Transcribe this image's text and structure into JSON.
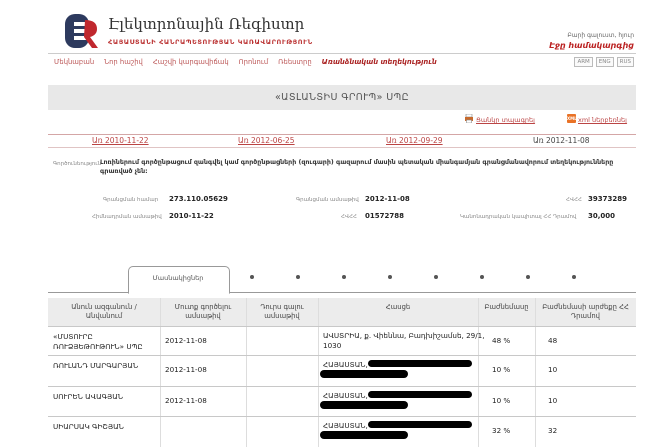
{
  "brand": {
    "title": "Էլեկտրոնային Ռեգիստր",
    "subtitle": "ՀԱՅԱՍՏԱՆԻ ՀԱՆՐԱՊԵՏՈՒԹՅԱՆ ԿԱՌԱՎԱՐՈՒԹՅՈՒՆ",
    "welcome": "Բարի գալուստ, հյուր",
    "login": "Էջը համակարգից",
    "accent_color": "#b22222"
  },
  "nav": [
    "Մեկնաբան",
    "Նոր հաշիվ",
    "Հաշվի կարգավիճակ",
    "Որոնում",
    "Ռեեստրը",
    "Առանձնական տեղեկություն"
  ],
  "nav_active_index": 5,
  "languages": [
    "ARM",
    "ENG",
    "RUS"
  ],
  "title": "«ԱՏԼԱՆՏԻՍ ԳՐՈՒՊ» ՍՊԸ",
  "downloads": {
    "pdf_label": "Ցանկը տպագրել",
    "xml_label": "xml ներբեռնել",
    "xml_icon_text": "XML"
  },
  "dates": [
    {
      "text": "Առ 2010-11-22",
      "link": true
    },
    {
      "text": "Առ 2012-06-25",
      "link": true
    },
    {
      "text": "Առ 2012-09-29",
      "link": true
    },
    {
      "text": "Առ 2012-11-08",
      "link": false
    }
  ],
  "activity": {
    "label": "Գործունեություն",
    "text": "Լոռիներում գործընթացում զանգվել կամ գործընթացների (զուգարի) գազարում մասին պետական միանգամյան գրանցմանավորում տեղեկությունները գրառված չեն:"
  },
  "fields": {
    "reg_number_label": "Գրանցման համար",
    "reg_number": "273.110.05629",
    "reg_date_label": "Գրանցման ամսաթիվ",
    "reg_date": "2012-11-08",
    "tin_label": "ՀՎՀՀ",
    "tin": "39373289",
    "founding_label": "Հիմնադրման ամսաթիվ",
    "founding": "2010-11-22",
    "code_label": "ՀՎՀՀ",
    "code": "01572788",
    "capital_label": "Կանոնադրական կապիտալ ՀՀ Դրամով",
    "capital": "30,000"
  },
  "tab": {
    "label": "Մասնակիցներ",
    "dot_count": 8
  },
  "table": {
    "headers": [
      "Անուն ազգանուն /\nԱնվանում",
      "Մուտք գործելու\nամսաթիվ",
      "Դուրս գալու\nամսաթիվ",
      "Հասցե",
      "Բաժնեմասը",
      "Բաժնեմասի արժեքը ՀՀ\nԴրամով"
    ],
    "rows": [
      {
        "name": "«ՄՍՏՈՒՐԸ\nՌՈՒՁՅԵԹՈՒԹՈՒՆ» ՍՊԸ",
        "entry": "2012-11-08",
        "exit": "",
        "address": "ԱՎՍՏՐԻԱ, ք. Վիեննա, Բադխիշամսե, 29/1,\n1030",
        "address_redacted": false,
        "share": "48 %",
        "value": "48"
      },
      {
        "name": "ՌՈՒԼԱՆԴ ՄԱՐԳԱՐՅԱՆ",
        "entry": "2012-11-08",
        "exit": "",
        "address": "ՀԱՅԱՍՏԱՆ,",
        "address_redacted": true,
        "share": "10 %",
        "value": "10"
      },
      {
        "name": "ՍՈՒՐԵՆ ԱՎԱԳՅԱՆ",
        "entry": "2012-11-08",
        "exit": "",
        "address": "ՀԱՅԱՍՏԱՆ,",
        "address_redacted": true,
        "share": "10 %",
        "value": "10"
      },
      {
        "name": "ՍԻԱՐՍԱԿ ԳԻՇՅԱՆ",
        "entry": "",
        "exit": "",
        "address": "ՀԱՅԱՍՏԱՆ,",
        "address_redacted": true,
        "share": "32 %",
        "value": "32"
      }
    ]
  }
}
